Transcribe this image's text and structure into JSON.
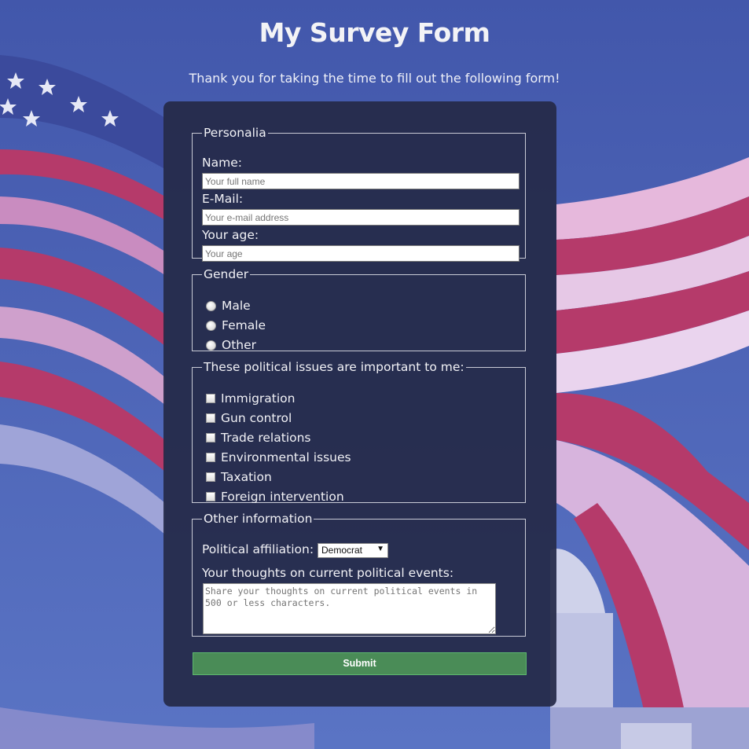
{
  "page": {
    "title": "My Survey Form",
    "subtitle": "Thank you for taking the time to fill out the following form!"
  },
  "personalia": {
    "legend": "Personalia",
    "name_label": "Name:",
    "name_placeholder": "Your full name",
    "email_label": "E-Mail:",
    "email_placeholder": "Your e-mail address",
    "age_label": "Your age:",
    "age_placeholder": "Your age"
  },
  "gender": {
    "legend": "Gender",
    "options": [
      "Male",
      "Female",
      "Other"
    ]
  },
  "issues": {
    "legend": "These political issues are important to me:",
    "options": [
      "Immigration",
      "Gun control",
      "Trade relations",
      "Environmental issues",
      "Taxation",
      "Foreign intervention"
    ]
  },
  "other": {
    "legend": "Other information",
    "affiliation_label": "Political affiliation:",
    "affiliation_selected": "Democrat",
    "thoughts_label": "Your thoughts on current political events:",
    "thoughts_placeholder": "Share your thoughts on current political events in 500 or less characters."
  },
  "submit_label": "Submit",
  "colors": {
    "card_bg": "#252a48",
    "submit_bg": "#4a8c57",
    "text": "#f2f2f6"
  },
  "icons": {
    "dropdown": "triangle-down"
  }
}
